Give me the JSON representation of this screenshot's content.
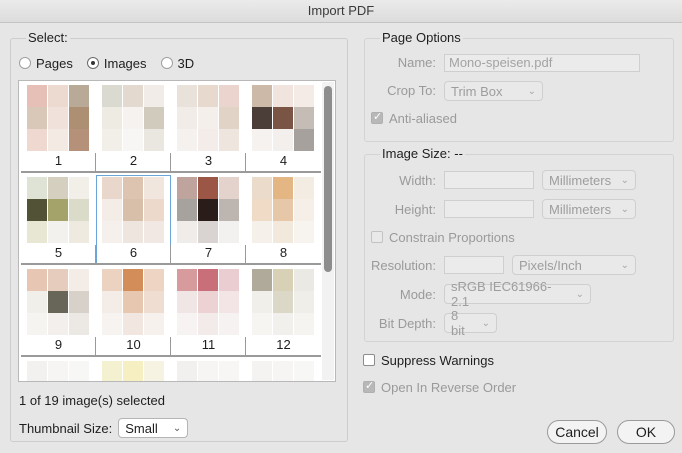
{
  "window": {
    "title": "Import PDF"
  },
  "select": {
    "label": "Select:",
    "modes": [
      {
        "label": "Pages",
        "checked": false
      },
      {
        "label": "Images",
        "checked": true
      },
      {
        "label": "3D",
        "checked": false
      }
    ],
    "thumbnails": [
      {
        "label": "1",
        "colors": [
          "#e6bfb7",
          "#ecd9cf",
          "#b9aa97",
          "#d9c7b8",
          "#f0e1db",
          "#ad8f73",
          "#eed8d0",
          "#f3eae4",
          "#b6917a",
          "#eee3de"
        ]
      },
      {
        "label": "2",
        "colors": [
          "#dadad0",
          "#e4d9cf",
          "#f1ece7",
          "#eeebe2",
          "#f5f2ef",
          "#d1cbbd",
          "#f2efe9",
          "#f7f6f4",
          "#e9e7df",
          "#f7f6f4"
        ]
      },
      {
        "label": "3",
        "colors": [
          "#e9e2da",
          "#e8d9cf",
          "#ecd4ce",
          "#f2ece8",
          "#f5efeb",
          "#e2d3c7",
          "#f5f1ee",
          "#f3ece8",
          "#eee5df",
          "#f7f5f3"
        ]
      },
      {
        "label": "4",
        "colors": [
          "#cdb9a8",
          "#f1e4de",
          "#f4ebe7",
          "#4b3d37",
          "#7a5546",
          "#c6bcb6",
          "#f5f2ef",
          "#f2efec",
          "#a7a19d",
          "#d9d5d1"
        ]
      },
      {
        "label": "5",
        "colors": [
          "#dfe3d6",
          "#d4cfbe",
          "#f2efe9",
          "#525236",
          "#a3a36a",
          "#dadcc9",
          "#e7e7d4",
          "#f3f1ed",
          "#eeeadf",
          "#f6f6f2"
        ]
      },
      {
        "label": "6",
        "colors": [
          "#e9d7cb",
          "#ddc4b1",
          "#f0e6de",
          "#f4ede7",
          "#d8bfaa",
          "#edd8cc",
          "#f6f0ec",
          "#eee5de",
          "#f1e8e3",
          "#f7f4f1"
        ]
      },
      {
        "label": "7",
        "colors": [
          "#bfa49d",
          "#9c5646",
          "#e4d2cc",
          "#a6a29e",
          "#2a1d19",
          "#bdb6b0",
          "#efece9",
          "#d9d4d1",
          "#f3f1ef",
          "#f6f5f4"
        ]
      },
      {
        "label": "8",
        "colors": [
          "#eadbcb",
          "#e4b684",
          "#f3ece3",
          "#f0dcc6",
          "#e6c8a8",
          "#f5efe8",
          "#f5f0ea",
          "#f2e8dc",
          "#f7f4f0",
          "#f8f7f5"
        ]
      },
      {
        "label": "9",
        "colors": [
          "#e7c7b4",
          "#e6ccbd",
          "#f3ece7",
          "#f1efea",
          "#676659",
          "#d7d1c9",
          "#f6f4f1",
          "#f2efec",
          "#ece9e5",
          "#f8f7f6"
        ]
      },
      {
        "label": "10",
        "colors": [
          "#ecd2c0",
          "#d28d59",
          "#edd4c3",
          "#f4ece6",
          "#e7c7af",
          "#f0ddd1",
          "#f7f3f0",
          "#f1e7e0",
          "#f6f1ed",
          "#f8f6f4"
        ]
      },
      {
        "label": "11",
        "colors": [
          "#d79b9d",
          "#c96f79",
          "#e9cdd0",
          "#f1e6e6",
          "#ecd2d3",
          "#f3e5e5",
          "#f7f3f3",
          "#f3ebea",
          "#f6f2f2",
          "#f8f7f7"
        ]
      },
      {
        "label": "12",
        "colors": [
          "#b0aa9b",
          "#d8d1b6",
          "#eae9e4",
          "#f0efea",
          "#dbd8c8",
          "#efeee9",
          "#f6f5f2",
          "#f1f0ec",
          "#f5f4f1",
          "#f8f8f6"
        ]
      },
      {
        "label": "",
        "colors": [
          "#f2f1ef",
          "#f6f5f3",
          "#f7f7f6",
          "#f6f6f5",
          "#f8f8f7",
          "#f8f8f8",
          "#f8f8f8",
          "#f8f8f8",
          "#f8f8f8",
          "#f8f8f8"
        ]
      },
      {
        "label": "",
        "colors": [
          "#f3f1cf",
          "#f5efc2",
          "#f6f3e2",
          "#f8f7f2",
          "#f8f8f7",
          "#f8f8f8",
          "#f8f8f8",
          "#f8f8f8",
          "#f8f8f8",
          "#f8f8f8"
        ]
      },
      {
        "label": "",
        "colors": [
          "#f2f0ee",
          "#f6f5f3",
          "#f7f6f5",
          "#f8f8f7",
          "#f8f8f8",
          "#f8f8f8",
          "#f8f8f8",
          "#f8f8f8",
          "#f8f8f8",
          "#f8f8f8"
        ]
      },
      {
        "label": "",
        "colors": [
          "#f4f3f1",
          "#f6f5f4",
          "#f7f7f6",
          "#f8f8f7",
          "#f8f8f8",
          "#f8f8f8",
          "#f8f8f8",
          "#f8f8f8",
          "#f8f8f8",
          "#f8f8f8"
        ]
      }
    ],
    "selected_index": 5,
    "status": "1 of 19 image(s) selected",
    "thumbnail_size_label": "Thumbnail Size:",
    "thumbnail_size_value": "Small"
  },
  "page_options": {
    "title": "Page Options",
    "name_label": "Name:",
    "name_value": "Mono-speisen.pdf",
    "crop_label": "Crop To:",
    "crop_value": "Trim Box",
    "anti_aliased": "Anti-aliased"
  },
  "image_size": {
    "title": "Image Size: --",
    "width_label": "Width:",
    "height_label": "Height:",
    "unit_width": "Millimeters",
    "unit_height": "Millimeters",
    "constrain": "Constrain Proportions",
    "resolution_label": "Resolution:",
    "resolution_unit": "Pixels/Inch",
    "mode_label": "Mode:",
    "mode_value": "sRGB IEC61966-2.1",
    "bitdepth_label": "Bit Depth:",
    "bitdepth_value": "8 bit"
  },
  "options": {
    "suppress_warnings": "Suppress Warnings",
    "reverse_order": "Open In Reverse Order"
  },
  "buttons": {
    "cancel": "Cancel",
    "ok": "OK"
  }
}
